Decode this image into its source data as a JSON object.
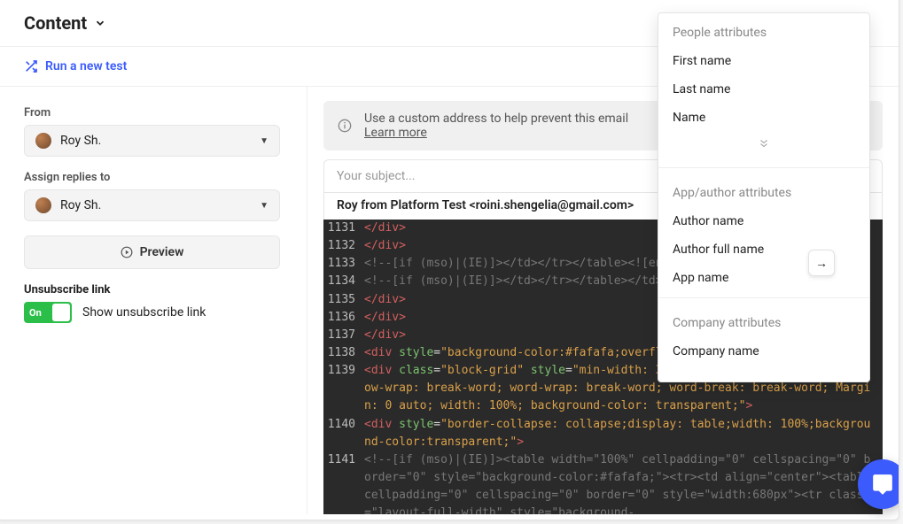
{
  "header": {
    "title": "Content"
  },
  "runtest": {
    "label": "Run a new test"
  },
  "sidebar": {
    "from_label": "From",
    "from_value": "Roy Sh.",
    "assign_label": "Assign replies to",
    "assign_value": "Roy Sh.",
    "preview_label": "Preview",
    "unsubscribe_header": "Unsubscribe link",
    "unsubscribe_toggle_label": "On",
    "unsubscribe_text": "Show unsubscribe link"
  },
  "infobar": {
    "text": "Use a custom address to help prevent this email ",
    "link": "Learn more"
  },
  "composer": {
    "subject_placeholder": "Your subject...",
    "from_line": "Roy from Platform Test <roini.shengelia@gmail.com>"
  },
  "editor": {
    "lines": [
      {
        "n": "1131",
        "html": "<span class='t-end'>&lt;/div&gt;</span>"
      },
      {
        "n": "1132",
        "html": "<span class='t-end'>&lt;/div&gt;</span>"
      },
      {
        "n": "1133",
        "html": "<span class='t-cmt'>&lt;!--[if (mso)|(IE)]&gt;&lt;/td&gt;&lt;/tr&gt;&lt;/table&gt;&lt;![endif]--&gt;</span>"
      },
      {
        "n": "1134",
        "html": "<span class='t-cmt'>&lt;!--[if (mso)|(IE)]&gt;&lt;/td&gt;&lt;/tr&gt;&lt;/table&gt;&lt;/td&gt;&lt;/tr&gt;&lt;/table&gt;&lt;![endif]--&gt;</span>"
      },
      {
        "n": "1135",
        "html": "<span class='t-end'>&lt;/div&gt;</span>"
      },
      {
        "n": "1136",
        "html": "<span class='t-end'>&lt;/div&gt;</span>"
      },
      {
        "n": "1137",
        "html": "<span class='t-end'>&lt;/div&gt;</span>"
      },
      {
        "n": "1138",
        "html": "<span class='t-tag'>&lt;div </span><span class='t-keyattr'>style</span><span class='t-op'>=</span><span class='t-str'>\"background-color:#fafafa;overflow:hidden\"</span><span class='t-tag'>&gt;</span>"
      },
      {
        "n": "1139",
        "html": "<span class='t-tag'>&lt;div </span><span class='t-keyattr'>class</span><span class='t-op'>=</span><span class='t-str'>\"block-grid\"</span> <span class='t-keyattr'>style</span><span class='t-op'>=</span><span class='t-str'>\"min-width: 320px; max-width: 680px; overflow-wrap: break-word; word-wrap: break-word; word-break: break-word; Margin: 0 auto; width: 100%; background-color: transparent;\"</span><span class='t-tag'>&gt;</span>"
      },
      {
        "n": "1140",
        "html": "<span class='t-tag'>&lt;div </span><span class='t-keyattr'>style</span><span class='t-op'>=</span><span class='t-str'>\"border-collapse: collapse;display: table;width: 100%;background-color:transparent;\"</span><span class='t-tag'>&gt;</span>"
      },
      {
        "n": "1141",
        "html": "<span class='t-cmt'>&lt;!--[if (mso)|(IE)]&gt;&lt;table width=\"100%\" cellpadding=\"0\" cellspacing=\"0\" border=\"0\" style=\"background-color:#fafafa;\"&gt;&lt;tr&gt;&lt;td align=\"center\"&gt;&lt;table cellpadding=\"0\" cellspacing=\"0\" border=\"0\" style=\"width:680px\"&gt;&lt;tr class=\"layout-full-width\" style=\"background-</span>"
      }
    ]
  },
  "dropdown": {
    "sections": [
      {
        "header": "People attributes",
        "items": [
          "First name",
          "Last name",
          "Name"
        ],
        "expand": true
      },
      {
        "header": "App/author attributes",
        "items": [
          "Author name",
          "Author full name",
          "App name"
        ],
        "expand": false
      },
      {
        "header": "Company attributes",
        "items": [
          "Company name"
        ],
        "expand": false
      }
    ]
  },
  "float_arrow": "→",
  "chat_fab_name": "chat-icon"
}
